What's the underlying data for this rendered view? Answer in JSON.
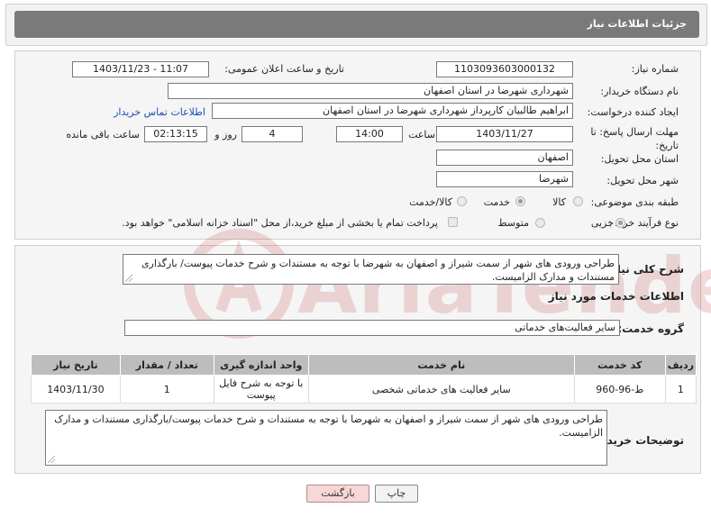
{
  "header": {
    "title": "جزئیات اطلاعات نیاز"
  },
  "form": {
    "need_number": {
      "label": "شماره نیاز:",
      "value": "1103093603000132"
    },
    "announce_datetime": {
      "label": "تاریخ و ساعت اعلان عمومی:",
      "value": "1403/11/23 - 11:07"
    },
    "buyer_org": {
      "label": "نام دستگاه خریدار:",
      "value": "شهرداری شهرضا در استان اصفهان"
    },
    "requester": {
      "label": "ایجاد کننده درخواست:",
      "value": "ابراهیم طالبیان کارپرداز شهرداری شهرضا در استان اصفهان",
      "contact_link": "اطلاعات تماس خریدار"
    },
    "deadline": {
      "label": "مهلت ارسال پاسخ: تا تاریخ:",
      "date": "1403/11/27",
      "time_label": "ساعت",
      "time": "14:00",
      "days": "4",
      "days_label": "روز و",
      "remaining": "02:13:15",
      "remaining_label": "ساعت باقی مانده"
    },
    "province": {
      "label": "استان محل تحویل:",
      "value": "اصفهان"
    },
    "city": {
      "label": "شهر محل تحویل:",
      "value": "شهرضا"
    },
    "category": {
      "label": "طبقه بندی موضوعی:",
      "options": [
        "کالا",
        "خدمت",
        "کالا/خدمت"
      ],
      "selected": "خدمت"
    },
    "purchase_type": {
      "label": "نوع فرآیند خرید :",
      "options": [
        "جزیی",
        "متوسط"
      ],
      "selected": "جزیی",
      "payment_note": "پرداخت تمام یا بخشی از مبلغ خرید،از محل \"اسناد خزانه اسلامی\" خواهد بود."
    }
  },
  "summary": {
    "label": "شرح کلی نیاز:",
    "text": "طراحی ورودی های شهر از سمت شیراز و اصفهان به شهرضا با توجه به مستندات و شرح خدمات پیوست/ بارگذاری مستندات و مدارک الزامیست."
  },
  "services": {
    "section_title": "اطلاعات خدمات مورد نیاز",
    "group_label": "گروه خدمت:",
    "group_value": "سایر فعالیت‌های خدماتی",
    "table": {
      "headers": [
        "ردیف",
        "کد خدمت",
        "نام خدمت",
        "واحد اندازه گیری",
        "تعداد / مقدار",
        "تاریخ نیاز"
      ],
      "rows": [
        [
          "1",
          "ط-96-960",
          "سایر فعالیت های خدماتی شخصی",
          "با توجه به شرح فایل پیوست",
          "1",
          "1403/11/30"
        ]
      ]
    }
  },
  "buyer_notes": {
    "label": "توضیحات خریدار:",
    "text": "طراحی ورودی های شهر از سمت شیراز و اصفهان به شهرضا با توجه به مستندات و شرح خدمات پیوست/بارگذاری مستندات و مدارک الزامیست."
  },
  "buttons": {
    "print": "چاپ",
    "back": "بازگشت"
  },
  "watermark": {
    "text": "AriaTender.neT"
  },
  "colors": {
    "header_bar": "#7a7a7a",
    "link": "#1a4fb3",
    "back_button": "#f7d7d7",
    "watermark": "#b42323"
  }
}
